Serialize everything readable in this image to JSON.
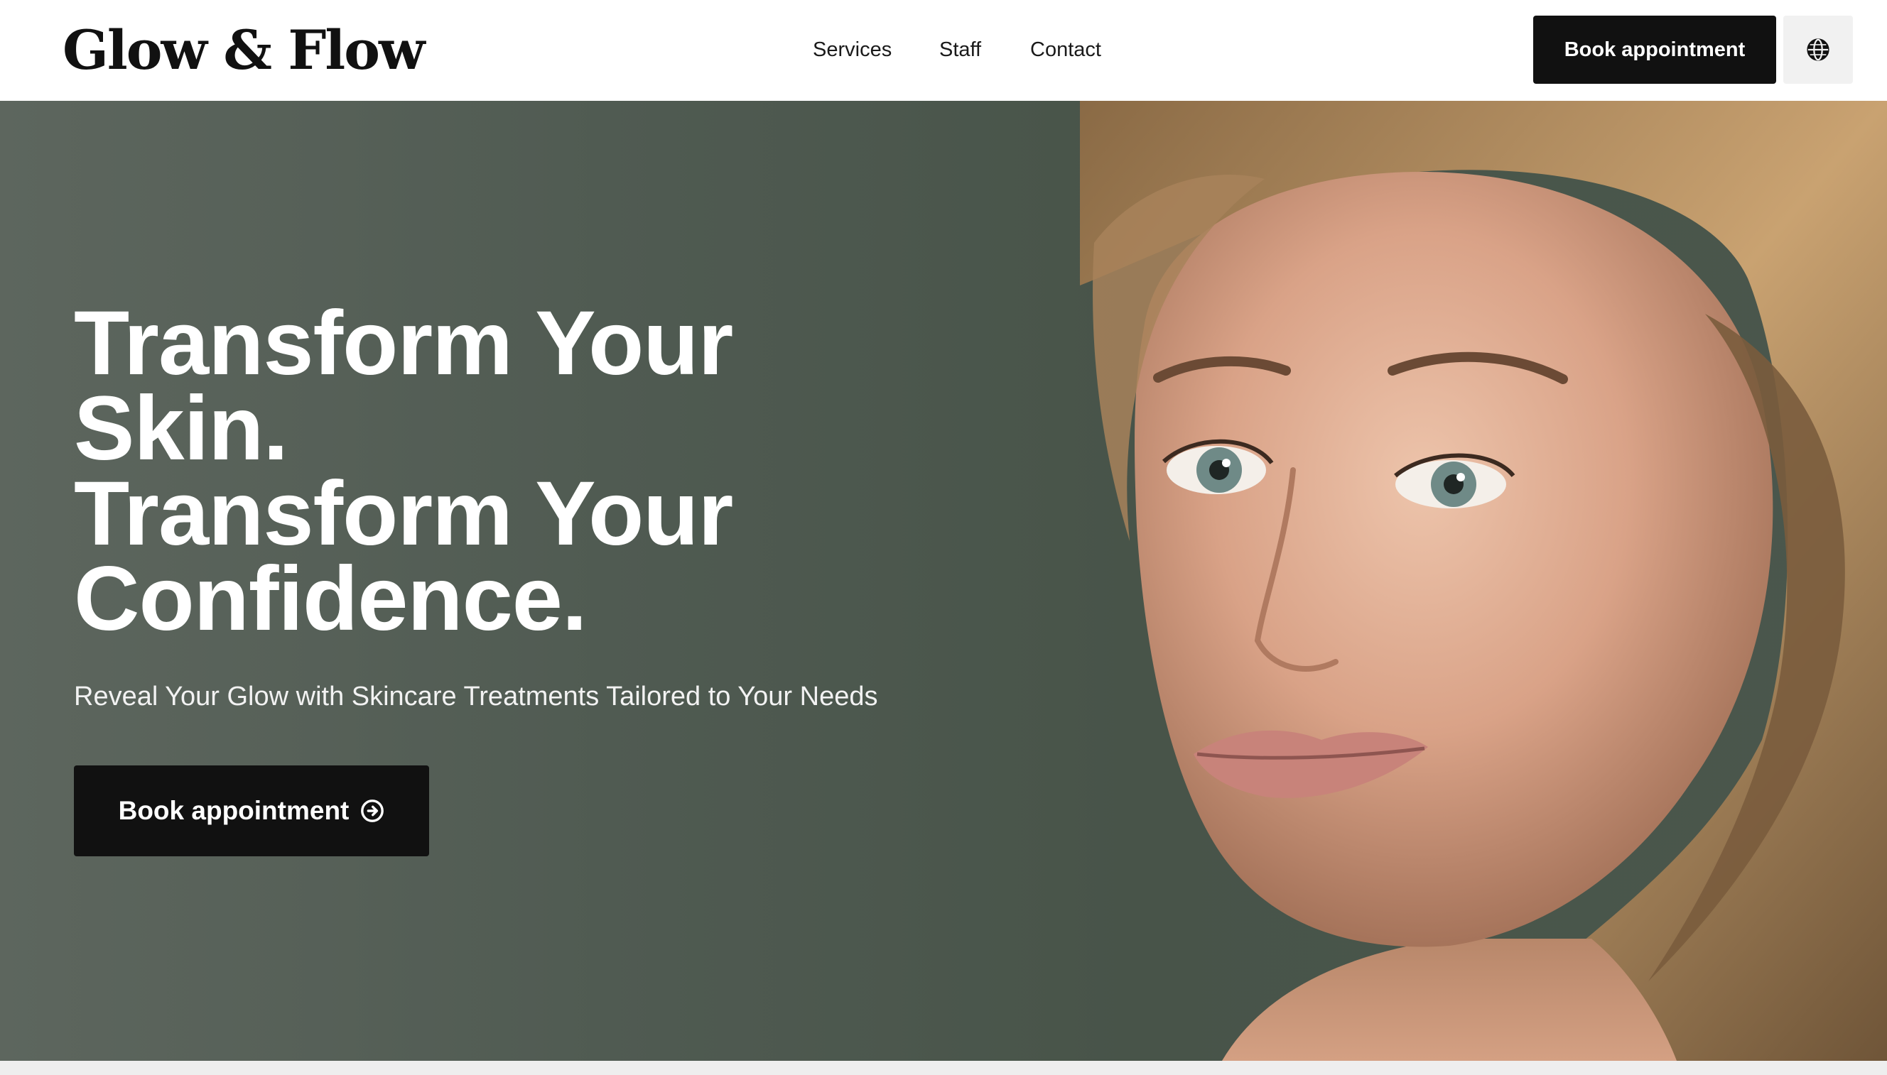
{
  "header": {
    "logo": "Glow & Flow",
    "nav": [
      {
        "label": "Services"
      },
      {
        "label": "Staff"
      },
      {
        "label": "Contact"
      }
    ],
    "cta_label": "Book appointment",
    "language_icon": "globe-icon"
  },
  "hero": {
    "title_lines": [
      "Transform Your",
      "Skin.",
      "Transform Your",
      "Confidence."
    ],
    "subtitle": "Reveal Your Glow with Skincare Treatments Tailored to Your Needs",
    "cta_label": "Book appointment",
    "cta_icon": "arrow-circle-right-icon",
    "image": "portrait-photo"
  },
  "colors": {
    "hero_background": "#4f5a51",
    "button_background": "#111111",
    "button_text": "#ffffff",
    "header_background": "#ffffff"
  }
}
